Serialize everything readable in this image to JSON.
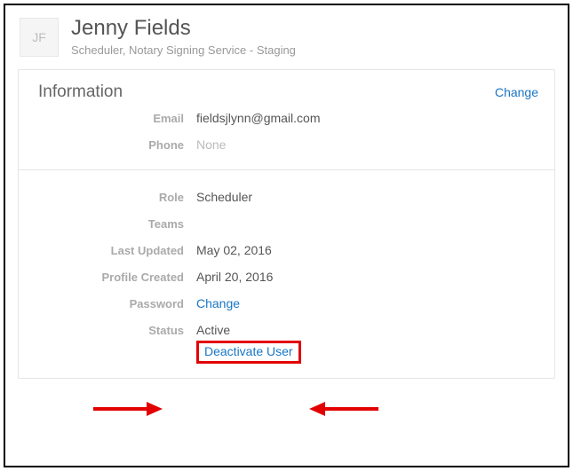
{
  "user": {
    "initials": "JF",
    "name": "Jenny Fields",
    "subtitle": "Scheduler, Notary Signing Service - Staging"
  },
  "section1": {
    "title": "Information",
    "change_label": "Change",
    "email_label": "Email",
    "email_value": "fieldsjlynn@gmail.com",
    "phone_label": "Phone",
    "phone_value": "None"
  },
  "section2": {
    "role_label": "Role",
    "role_value": "Scheduler",
    "teams_label": "Teams",
    "teams_value": "",
    "updated_label": "Last Updated",
    "updated_value": "May 02, 2016",
    "created_label": "Profile Created",
    "created_value": "April 20, 2016",
    "password_label": "Password",
    "password_link": "Change",
    "status_label": "Status",
    "status_value": "Active",
    "deactivate_label": "Deactivate User"
  }
}
